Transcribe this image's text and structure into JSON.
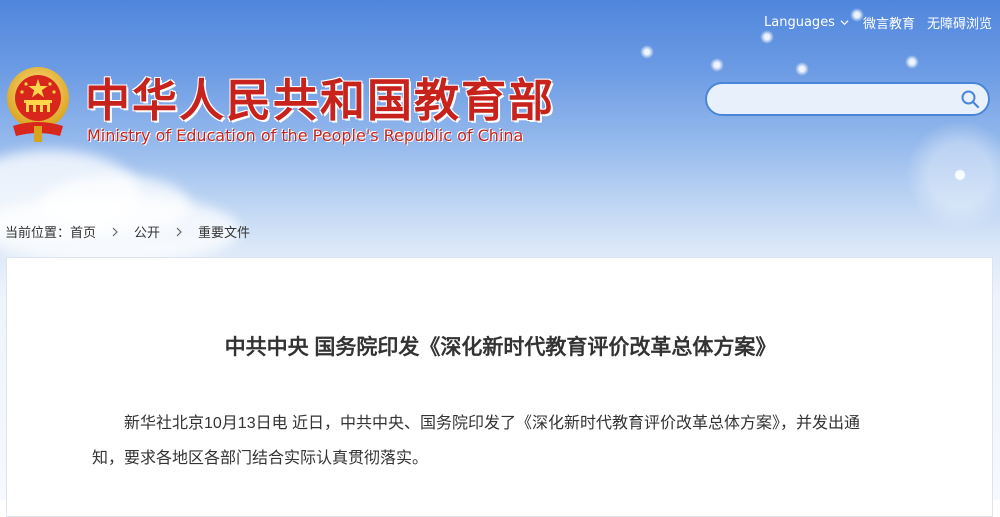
{
  "header": {
    "languages_label": "Languages",
    "links": [
      "微言教育",
      "无障碍浏览"
    ],
    "site_title_cn": "中华人民共和国教育部",
    "site_title_en": "Ministry of Education of the People's Republic of China",
    "search": {
      "placeholder": "",
      "value": ""
    },
    "icons": {
      "emblem": "national-emblem",
      "search": "search-icon",
      "languages": "chevron-down-icon"
    }
  },
  "breadcrumb": {
    "prefix": "当前位置：",
    "items": [
      "首页",
      "公开",
      "重要文件"
    ],
    "separator_icon": "chevron-right-icon"
  },
  "article": {
    "title": "中共中央 国务院印发《深化新时代教育评价改革总体方案》",
    "body": "新华社北京10月13日电 近日，中共中央、国务院印发了《深化新时代教育评价改革总体方案》，并发出通知，要求各地区各部门结合实际认真贯彻落实。"
  },
  "colors": {
    "brand_red": "#c8221c",
    "sky_blue": "#4f86dc",
    "search_border": "#4a86d8",
    "text": "#333333"
  }
}
